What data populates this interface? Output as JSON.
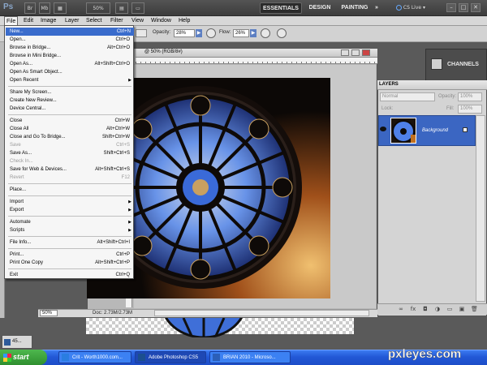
{
  "app": {
    "logo": "Ps",
    "view_mode": "",
    "zoom": "50%",
    "arrange": "",
    "workspaces": {
      "active": "ESSENTIALS",
      "design": "DESIGN",
      "painting": "PAINTING",
      "more": "»"
    },
    "cs_live": "CS Live",
    "window_controls": [
      "–",
      "□",
      "✕"
    ]
  },
  "menubar": [
    "File",
    "Edit",
    "Image",
    "Layer",
    "Select",
    "Filter",
    "View",
    "Window",
    "Help"
  ],
  "options": {
    "opacity_label": "Opacity:",
    "opacity_value": "28%",
    "flow_label": "Flow:",
    "flow_value": "26%",
    "arrow": "▶"
  },
  "file_menu": [
    {
      "label": "New...",
      "shortcut": "Ctrl+N",
      "highlighted": true
    },
    {
      "label": "Open...",
      "shortcut": "Ctrl+O"
    },
    {
      "label": "Browse in Bridge...",
      "shortcut": "Alt+Ctrl+O"
    },
    {
      "label": "Browse in Mini Bridge...",
      "shortcut": ""
    },
    {
      "label": "Open As...",
      "shortcut": "Alt+Shift+Ctrl+O"
    },
    {
      "label": "Open As Smart Object...",
      "shortcut": ""
    },
    {
      "label": "Open Recent",
      "submenu": true
    },
    {
      "separator": true
    },
    {
      "label": "Share My Screen...",
      "shortcut": ""
    },
    {
      "label": "Create New Review...",
      "shortcut": ""
    },
    {
      "label": "Device Central...",
      "shortcut": ""
    },
    {
      "separator": true
    },
    {
      "label": "Close",
      "shortcut": "Ctrl+W"
    },
    {
      "label": "Close All",
      "shortcut": "Alt+Ctrl+W"
    },
    {
      "label": "Close and Go To Bridge...",
      "shortcut": "Shift+Ctrl+W"
    },
    {
      "label": "Save",
      "shortcut": "Ctrl+S",
      "disabled": true
    },
    {
      "label": "Save As...",
      "shortcut": "Shift+Ctrl+S"
    },
    {
      "label": "Check In...",
      "shortcut": "",
      "disabled": true
    },
    {
      "label": "Save for Web & Devices...",
      "shortcut": "Alt+Shift+Ctrl+S"
    },
    {
      "label": "Revert",
      "shortcut": "F12",
      "disabled": true
    },
    {
      "separator": true
    },
    {
      "label": "Place...",
      "shortcut": ""
    },
    {
      "separator": true
    },
    {
      "label": "Import",
      "submenu": true
    },
    {
      "label": "Export",
      "submenu": true
    },
    {
      "separator": true
    },
    {
      "label": "Automate",
      "submenu": true
    },
    {
      "label": "Scripts",
      "submenu": true
    },
    {
      "separator": true
    },
    {
      "label": "File Info...",
      "shortcut": "Alt+Shift+Ctrl+I"
    },
    {
      "separator": true
    },
    {
      "label": "Print...",
      "shortcut": "Ctrl+P"
    },
    {
      "label": "Print One Copy",
      "shortcut": "Alt+Shift+Ctrl+P"
    },
    {
      "separator": true
    },
    {
      "label": "Exit",
      "shortcut": "Ctrl+Q"
    }
  ],
  "document": {
    "title": "@ 50% (RGB/8#)",
    "zoom_field": "50%",
    "doc_size": "Doc: 2.73M/2.73M"
  },
  "minimized_doc": "45...",
  "panels": {
    "channels_label": "CHANNELS",
    "layers_label": "LAYERS",
    "blend_mode": "Normal",
    "opacity_label": "Opacity:",
    "opacity_value": "100%",
    "lock_label": "Lock:",
    "fill_label": "Fill:",
    "fill_value": "100%",
    "layer_name": "Background",
    "footer_icons": [
      "∞",
      "fx",
      "◘",
      "◑",
      "▭",
      "▣",
      "🗑"
    ]
  },
  "taskbar": {
    "start": "start",
    "tasks": [
      {
        "label": "Crit - Worth1000.com...",
        "icon_color": "#2a7de1"
      },
      {
        "label": "Adobe Photoshop CS5",
        "icon_color": "#1b4f8f"
      },
      {
        "label": "BRIAN 2010 - Microso...",
        "icon_color": "#2b5fb8"
      }
    ]
  },
  "watermark": {
    "part1": "pxl",
    "part2": "eyes.com"
  },
  "colors": {
    "menu_highlight": "#3a6ccc",
    "layer_selected": "#3b66c2",
    "taskbar": "#2258d6"
  }
}
